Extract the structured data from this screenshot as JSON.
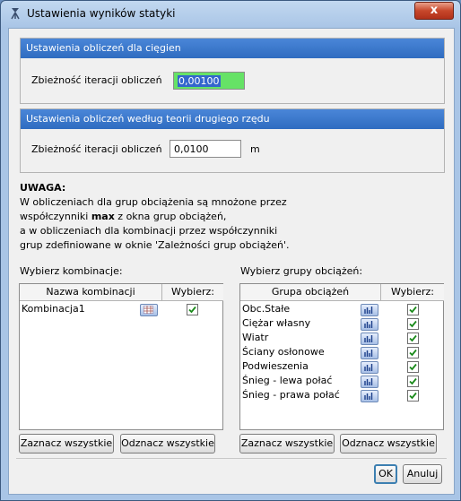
{
  "window": {
    "title": "Ustawienia wyników statyki",
    "close_label": "x"
  },
  "section_cables": {
    "header": "Ustawienia obliczeń dla cięgien",
    "label": "Zbieżność iteracji obliczeń",
    "value": "0,00100"
  },
  "section_second_order": {
    "header": "Ustawienia obliczeń według teorii drugiego rzędu",
    "label": "Zbieżność iteracji obliczeń",
    "value": "0,0100",
    "unit": "m"
  },
  "note": {
    "title": "UWAGA:",
    "line1": "W obliczeniach dla grup obciążenia są mnożone przez",
    "line2_pre": "współczynniki ",
    "line2_bold": "max",
    "line2_post": " z okna grup obciążeń,",
    "line3": "a w obliczeniach dla kombinacji przez współczynniki",
    "line4": "grup zdefiniowane w oknie 'Zależności grup obciążeń'."
  },
  "combinations": {
    "title": "Wybierz kombinacje:",
    "col_name": "Nazwa kombinacji",
    "col_select": "Wybierz:",
    "rows": [
      {
        "name": "Kombinacja1",
        "checked": true
      }
    ],
    "select_all": "Zaznacz wszystkie",
    "deselect_all": "Odznacz wszystkie"
  },
  "load_groups": {
    "title": "Wybierz grupy obciążeń:",
    "col_name": "Grupa obciążeń",
    "col_select": "Wybierz:",
    "rows": [
      {
        "name": "Obc.Stałe",
        "checked": true
      },
      {
        "name": "Ciężar własny",
        "checked": true
      },
      {
        "name": "Wiatr",
        "checked": true
      },
      {
        "name": "Ściany osłonowe",
        "checked": true
      },
      {
        "name": "Podwieszenia",
        "checked": true
      },
      {
        "name": "Śnieg - lewa połać",
        "checked": true
      },
      {
        "name": "Śnieg - prawa połać",
        "checked": true
      }
    ],
    "select_all": "Zaznacz wszystkie",
    "deselect_all": "Odznacz wszystkie"
  },
  "footer": {
    "ok_label": "OK",
    "cancel_label": "Anuluj"
  }
}
